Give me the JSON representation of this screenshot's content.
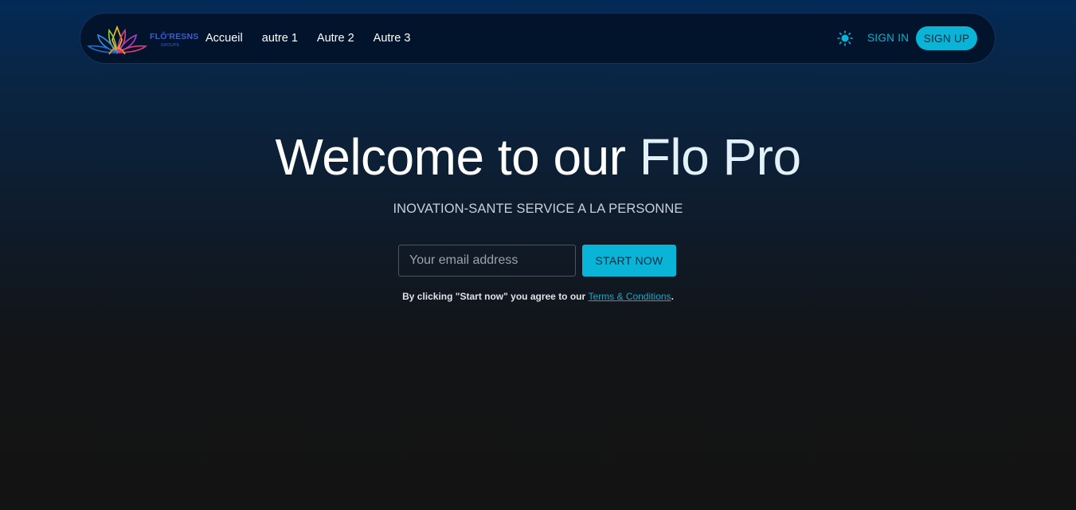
{
  "brand": {
    "name": "FLÔ'RESNS",
    "sub": "GROUPE"
  },
  "nav": {
    "links": [
      "Accueil",
      "autre 1",
      "Autre 2",
      "Autre 3"
    ],
    "sign_in": "SIGN IN",
    "sign_up": "SIGN UP",
    "theme_icon": "sun-icon"
  },
  "hero": {
    "title_main": "Welcome to our ",
    "title_accent": "Flo Pro",
    "subtitle": "INOVATION-SANTE SERVICE A LA PERSONNE"
  },
  "form": {
    "email_placeholder": "Your email address",
    "email_value": "",
    "submit_label": "START NOW",
    "terms_prefix": "By clicking \"Start now\" you agree to our ",
    "terms_link": "Terms & Conditions",
    "terms_suffix": "."
  },
  "colors": {
    "accent": "#0ab4d6",
    "nav_bg": "#02142c",
    "page_bg_top": "#032a57",
    "page_bg_bottom": "#131313"
  }
}
